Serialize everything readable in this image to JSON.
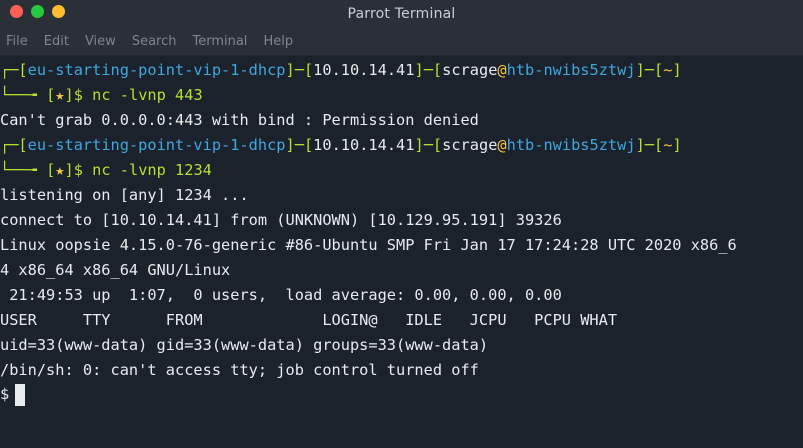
{
  "window": {
    "title": "Parrot Terminal"
  },
  "menu": {
    "items": [
      "File",
      "Edit",
      "View",
      "Search",
      "Terminal",
      "Help"
    ]
  },
  "terminal": {
    "prompt1": {
      "corner": "┌─",
      "open1": "[",
      "host_tag": "eu-starting-point-vip-1-dhcp",
      "close1": "]",
      "dash1": "─",
      "open2": "[",
      "ip": "10.10.14.41",
      "close2": "]",
      "dash2": "─",
      "open3": "[",
      "user": "scrage",
      "at": "@",
      "hostname": "htb-nwibs5ztwj",
      "close3": "]",
      "dash3": "─",
      "open4": "[",
      "path": "~",
      "close4": "]",
      "lower_corner": "└──╼ ",
      "mark_open": "[",
      "star": "★",
      "mark_close": "]",
      "dollar": "$ ",
      "command": "nc -lvnp 443"
    },
    "out1": "Can't grab 0.0.0.0:443 with bind : Permission denied",
    "prompt2": {
      "command": "nc -lvnp 1234"
    },
    "output_lines": [
      "listening on [any] 1234 ...",
      "connect to [10.10.14.41] from (UNKNOWN) [10.129.95.191] 39326",
      "Linux oopsie 4.15.0-76-generic #86-Ubuntu SMP Fri Jan 17 17:24:28 UTC 2020 x86_6",
      "4 x86_64 x86_64 GNU/Linux",
      " 21:49:53 up  1:07,  0 users,  load average: 0.00, 0.00, 0.00",
      "USER     TTY      FROM             LOGIN@   IDLE   JCPU   PCPU WHAT",
      "uid=33(www-data) gid=33(www-data) groups=33(www-data)",
      "/bin/sh: 0: can't access tty; job control turned off"
    ],
    "shell_prompt": "$"
  }
}
